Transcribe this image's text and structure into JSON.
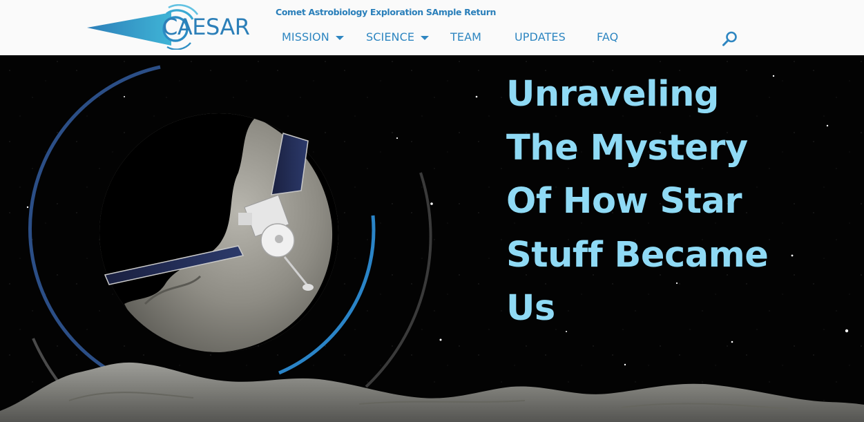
{
  "site": {
    "logo_text": "CAESAR",
    "tagline": "Comet Astrobiology Exploration SAmple Return"
  },
  "nav": {
    "items": [
      {
        "label": "MISSION",
        "has_dropdown": true
      },
      {
        "label": "SCIENCE",
        "has_dropdown": true
      },
      {
        "label": "TEAM",
        "has_dropdown": false
      },
      {
        "label": "UPDATES",
        "has_dropdown": false
      },
      {
        "label": "FAQ",
        "has_dropdown": false
      }
    ],
    "search_icon": "search-icon"
  },
  "hero": {
    "headline_lines": [
      "Unraveling",
      "The Mystery",
      "Of How Star",
      "Stuff Became",
      "Us"
    ]
  },
  "colors": {
    "brand_blue": "#2e86c1",
    "headline": "#8fdaf5",
    "header_bg": "#fafafa",
    "space_bg": "#030303"
  }
}
